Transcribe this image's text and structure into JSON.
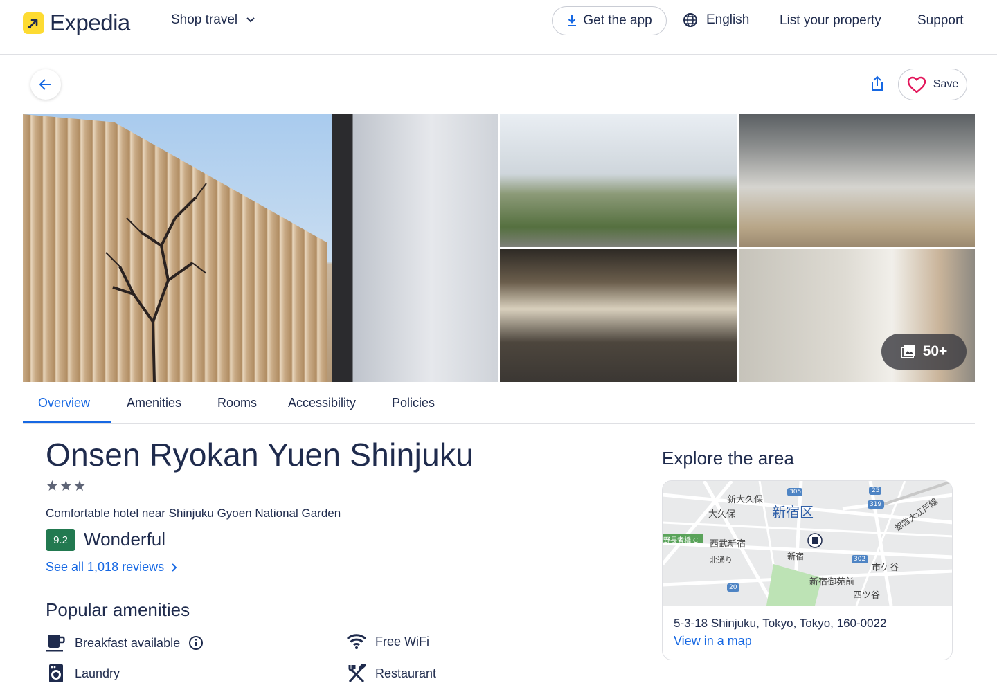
{
  "header": {
    "brand": "Expedia",
    "shop_travel": "Shop travel",
    "get_app": "Get the app",
    "language": "English",
    "list_property": "List your property",
    "support": "Support"
  },
  "actions": {
    "save": "Save"
  },
  "gallery": {
    "more_count": "50+"
  },
  "tabs": [
    {
      "label": "Overview",
      "active": true
    },
    {
      "label": "Amenities"
    },
    {
      "label": "Rooms"
    },
    {
      "label": "Accessibility"
    },
    {
      "label": "Policies"
    }
  ],
  "hotel": {
    "name": "Onsen Ryokan Yuen Shinjuku",
    "stars": "★★★",
    "tagline": "Comfortable hotel near Shinjuku Gyoen National Garden",
    "rating": "9.2",
    "rating_word": "Wonderful",
    "reviews_link": "See all 1,018 reviews"
  },
  "amenities": {
    "heading": "Popular amenities",
    "items": [
      "Breakfast available",
      "Free WiFi",
      "Laundry",
      "Restaurant"
    ]
  },
  "explore": {
    "title": "Explore the area",
    "address": "5-3-18 Shinjuku, Tokyo, Tokyo, 160-0022",
    "view_map": "View in a map",
    "map_labels": [
      "新大久保",
      "大久保",
      "新宿区",
      "西武新宿",
      "新宿",
      "新宿御苑前",
      "市ケ谷",
      "四ツ谷",
      "北通り",
      "都営大江戸線",
      "野長者橋IC",
      "305",
      "25",
      "319",
      "302",
      "20"
    ]
  },
  "colors": {
    "brand_yellow": "#fddb32",
    "link_blue": "#1668e3",
    "rating_green": "#227950",
    "text": "#1f2b4d"
  }
}
